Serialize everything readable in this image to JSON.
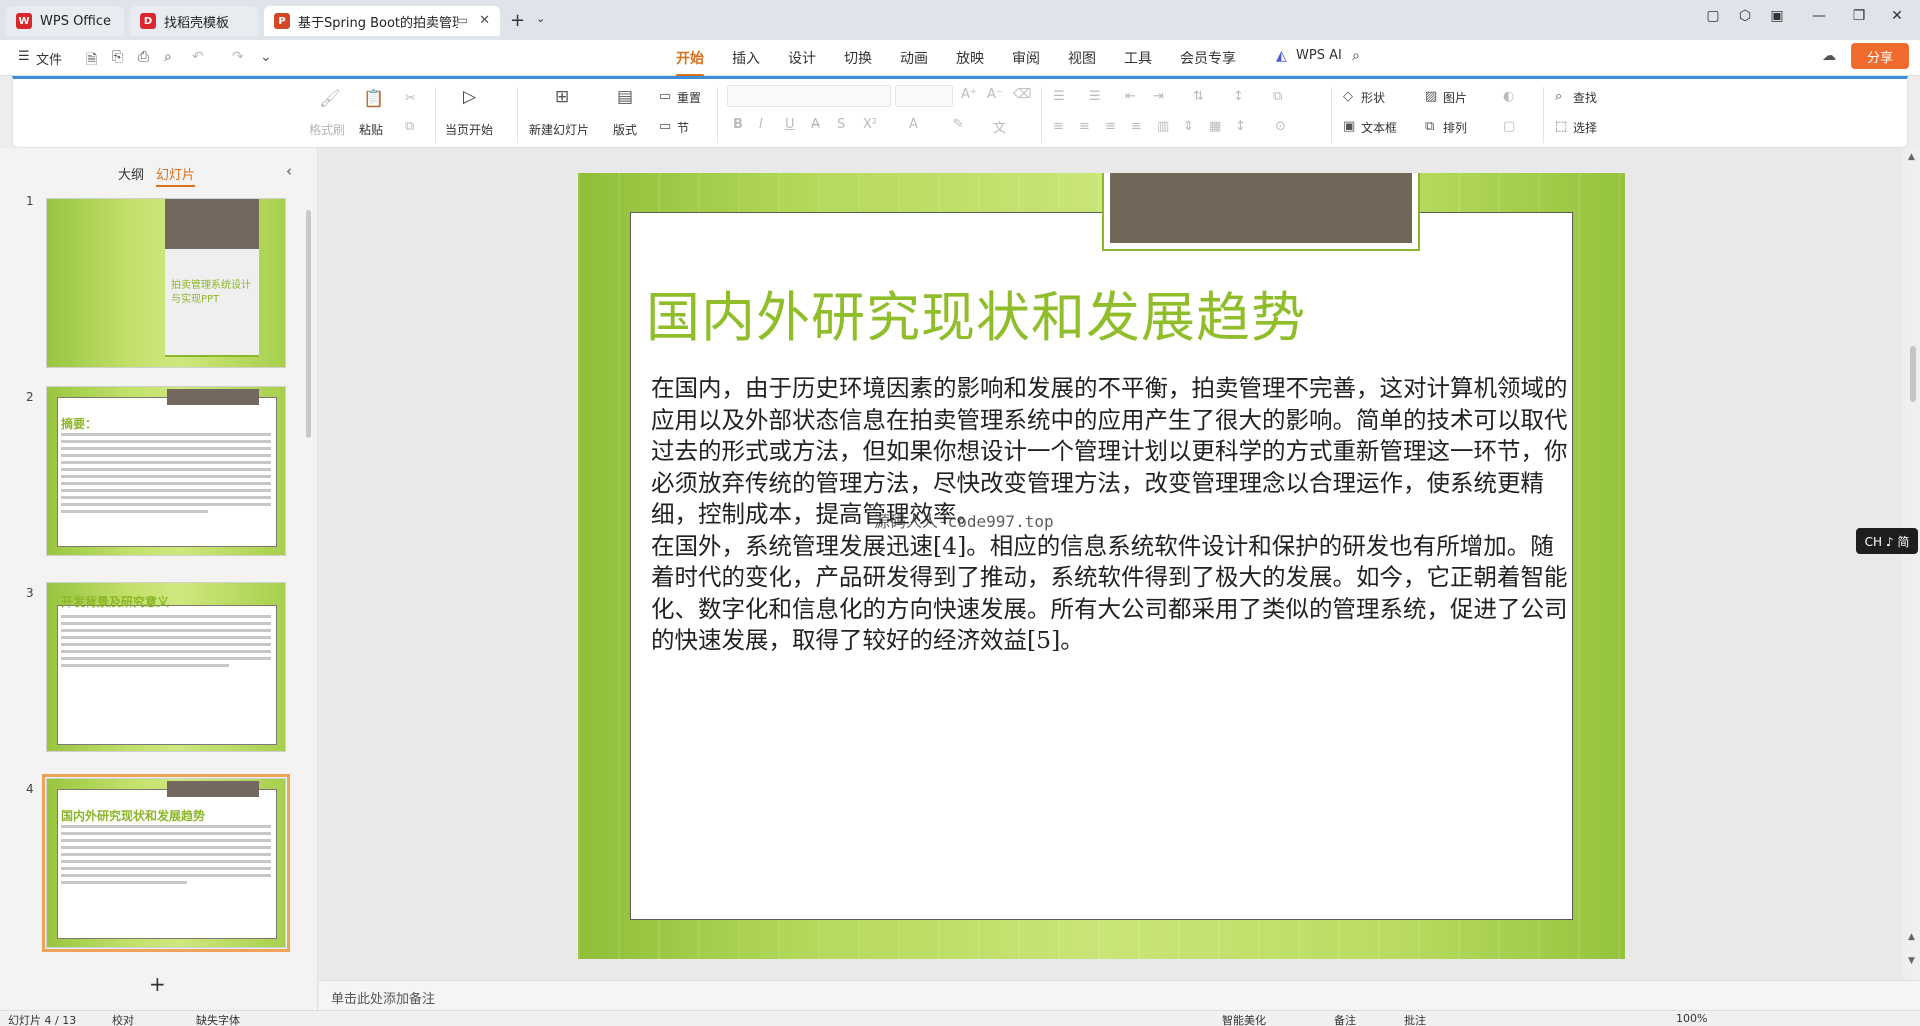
{
  "tabs": [
    {
      "label": "WPS Office",
      "icon": "wps-logo-icon",
      "color": "#d9272e"
    },
    {
      "label": "找稻壳模板",
      "icon": "docer-logo-icon",
      "color": "#d9272e"
    },
    {
      "label": "基于Spring Boot的拍卖管理",
      "icon": "ppt-logo-icon",
      "color": "#d24726",
      "active": true
    }
  ],
  "menu": {
    "file_label": "文件",
    "tabs": [
      "开始",
      "插入",
      "设计",
      "切换",
      "动画",
      "放映",
      "审阅",
      "视图",
      "工具",
      "会员专享"
    ],
    "active_tab": "开始",
    "wps_ai": "WPS AI",
    "share": "分享"
  },
  "ribbon": {
    "format_painter": "格式刷",
    "paste": "粘贴",
    "from_current": "当页开始",
    "new_slide": "新建幻灯片",
    "layout": "版式",
    "reset": "重置",
    "section": "节",
    "shape": "形状",
    "picture": "图片",
    "find": "查找",
    "textbox": "文本框",
    "arrange": "排列",
    "select": "选择"
  },
  "left_panel": {
    "outline_tab": "大纲",
    "slides_tab": "幻灯片",
    "thumbnails": [
      {
        "num": "1",
        "title": "拍卖管理系统设计与实现PPT"
      },
      {
        "num": "2",
        "title": "摘要："
      },
      {
        "num": "3",
        "title": "开发背景及研究意义"
      },
      {
        "num": "4",
        "title": "国内外研究现状和发展趋势",
        "selected": true
      }
    ]
  },
  "slide": {
    "title": "国内外研究现状和发展趋势",
    "para1": "在国内，由于历史环境因素的影响和发展的不平衡，拍卖管理不完善，这对计算机领域的应用以及外部状态信息在拍卖管理系统中的应用产生了很大的影响。简单的技术可以取代过去的形式或方法，但如果你想设计一个管理计划以更科学的方式重新管理这一环节，你必须放弃传统的管理方法，尽快改变管理方法，改变管理理念以合理运作，使系统更精细，控制成本，提高管理效率。",
    "para2": "在国外，系统管理发展迅速[4]。相应的信息系统软件设计和保护的研发也有所增加。随着时代的变化，产品研发得到了推动，系统软件得到了极大的发展。如今，它正朝着智能化、数字化和信息化的方向快速发展。所有大公司都采用了类似的管理系统，促进了公司的快速发展，取得了较好的经济效益[5]。",
    "watermark": "源码人人-code997.top"
  },
  "notes_placeholder": "单击此处添加备注",
  "ime": "CH ♪ 简",
  "status": {
    "slide_info": "幻灯片 4 / 13",
    "proofread": "校对",
    "missing_font": "缺失字体",
    "smart_beautify": "智能美化",
    "notes": "备注",
    "comments": "批注",
    "zoom": "100%"
  },
  "colors": {
    "accent": "#d9701a",
    "ribbon_top": "#3a8fd6",
    "slide_green": "#8fbe2a",
    "slide_dark_tab": "#716759"
  }
}
